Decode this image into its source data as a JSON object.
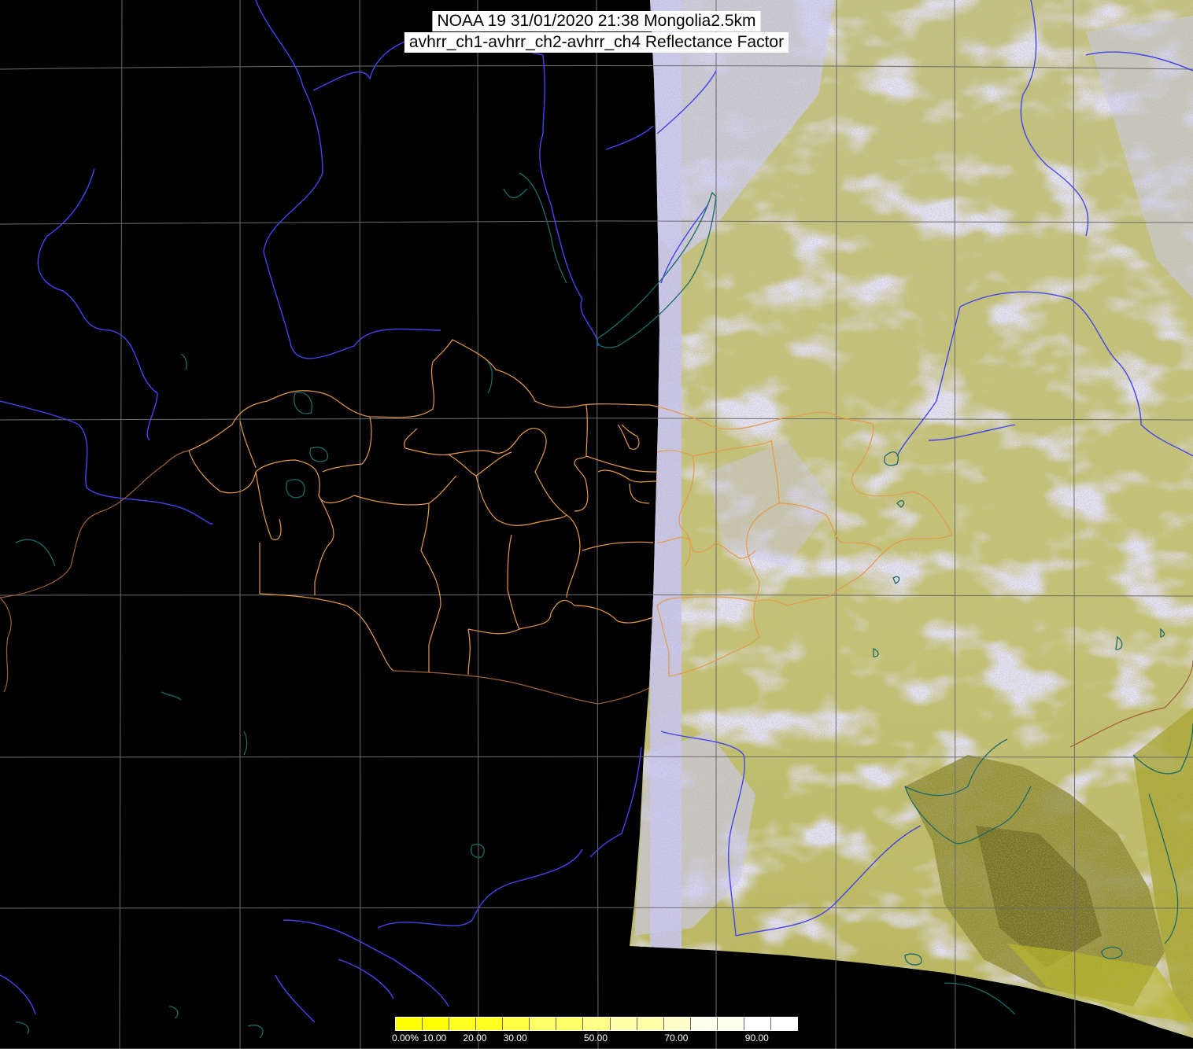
{
  "title": {
    "line1": "NOAA 19 31/01/2020 21:38 Mongolia2.5km",
    "line2": "avhrr_ch1-avhrr_ch2-avhrr_ch4 Reflectance Factor"
  },
  "colorbar": {
    "labels": [
      "0.00%",
      "10.00",
      "20.00",
      "30.00",
      "50.00",
      "70.00",
      "90.00"
    ],
    "label_values": [
      0,
      10,
      20,
      30,
      50,
      70,
      90
    ],
    "range": [
      0,
      100
    ],
    "colors": [
      "#ffff00",
      "#ffff22",
      "#ffff44",
      "#ffff66",
      "#ffff88",
      "#ffffaa",
      "#ffffcc",
      "#ffffee",
      "#ffffff"
    ]
  },
  "colors": {
    "background": "#000000",
    "swath_light": "#c3c47a",
    "swath_cloud": "#c8c8f2",
    "swath_dark": "#8f8f2c",
    "grid": "#6c6c6c",
    "rivers": "#4444ee",
    "lakes": "#1c6a6a",
    "borders": "#e69a4a",
    "country_border": "#a0603a"
  }
}
